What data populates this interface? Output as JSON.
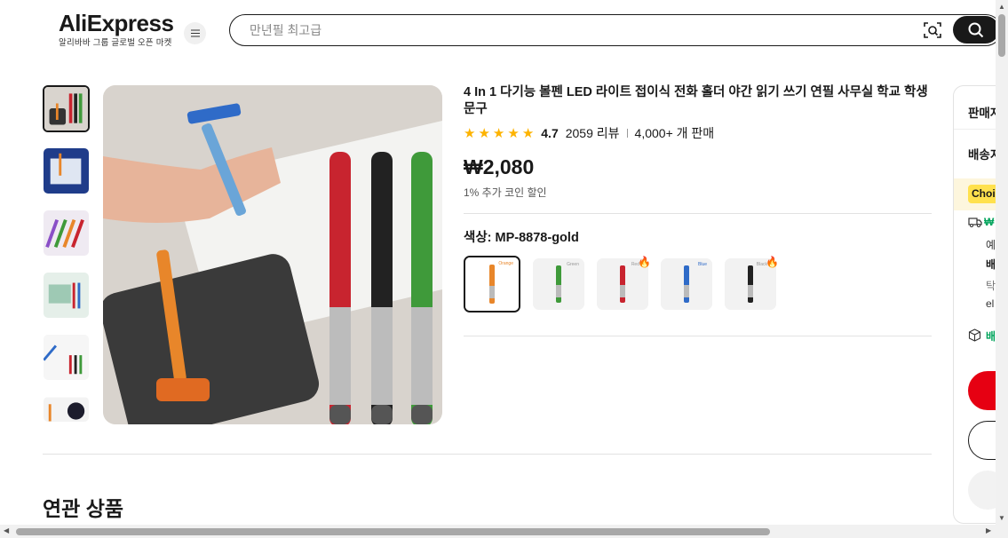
{
  "header": {
    "logo": "AliExpress",
    "logo_sub": "알리바바 그룹 글로벌 오픈 마켓",
    "search_placeholder": "만년필 최고급"
  },
  "product": {
    "title": "4 In 1 다기능 볼펜 LED 라이트 접이식 전화 홀더 야간 읽기 쓰기 연필 사무실 학교 학생 문구",
    "rating": "4.7",
    "reviews": "2059 리뷰",
    "sold": "4,000+ 개 판매",
    "stars": 5,
    "price": "₩2,080",
    "coin_discount": "1% 추가 코인 할인",
    "color_label": "색상: MP-8878-gold",
    "variants": [
      {
        "name": "Orange",
        "color": "#e8862a",
        "hot": false,
        "selected": true
      },
      {
        "name": "Green",
        "color": "#3f9a3a",
        "hot": false,
        "selected": false
      },
      {
        "name": "Red",
        "color": "#c8242f",
        "hot": true,
        "selected": false
      },
      {
        "name": "Blue",
        "color": "#2f6bc8",
        "hot": false,
        "selected": false
      },
      {
        "name": "Black",
        "color": "#222222",
        "hot": true,
        "selected": false
      }
    ]
  },
  "section": {
    "related_title": "연관 상품"
  },
  "panel": {
    "seller": "판매자",
    "shipping": "배송지",
    "choice": "Choice",
    "free_shipping": "₩",
    "line1": "예",
    "line2": "배",
    "line3": "탁",
    "line4": "el",
    "returns": "배"
  },
  "colors": {
    "accent": "#e60012",
    "text": "#191919",
    "star": "#fdb300",
    "choice": "#ffe14d"
  }
}
